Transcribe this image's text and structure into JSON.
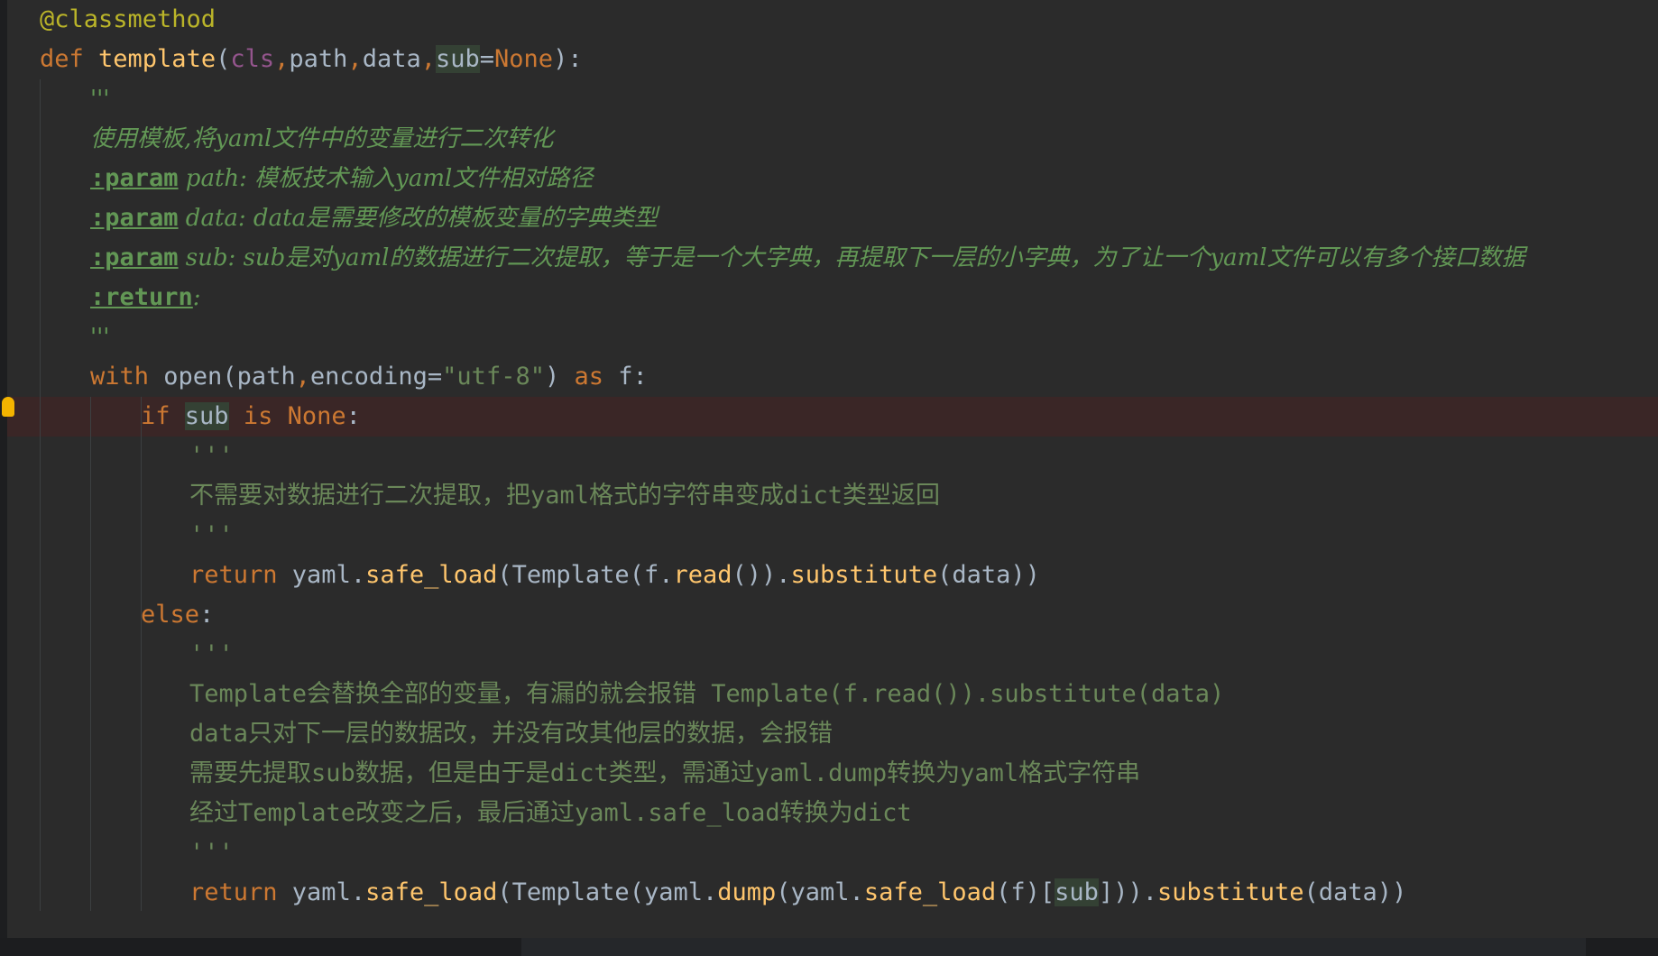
{
  "code_lines": [
    {
      "indent": 0,
      "tokens": [
        {
          "t": "@classmethod",
          "c": "dec"
        }
      ]
    },
    {
      "indent": 0,
      "tokens": [
        {
          "t": "def ",
          "c": "kw"
        },
        {
          "t": "template",
          "c": "fn"
        },
        {
          "t": "(",
          "c": "call"
        },
        {
          "t": "cls",
          "c": "self"
        },
        {
          "t": ",",
          "c": "kw"
        },
        {
          "t": "path",
          "c": "call"
        },
        {
          "t": ",",
          "c": "kw"
        },
        {
          "t": "data",
          "c": "call"
        },
        {
          "t": ",",
          "c": "kw"
        },
        {
          "t": "sub",
          "c": "hlvar"
        },
        {
          "t": "=",
          "c": "call"
        },
        {
          "t": "None",
          "c": "kw"
        },
        {
          "t": "):",
          "c": "call"
        }
      ]
    },
    {
      "indent": 1,
      "tokens": [
        {
          "t": "'''",
          "c": "cmt"
        }
      ]
    },
    {
      "indent": 1,
      "tokens": [
        {
          "t": "使用模板,将yaml文件中的变量进行二次转化",
          "c": "cmt"
        }
      ]
    },
    {
      "indent": 1,
      "tokens": [
        {
          "t": ":param",
          "c": "tag"
        },
        {
          "t": " path: 模板技术输入yaml文件相对路径",
          "c": "cmt"
        }
      ]
    },
    {
      "indent": 1,
      "tokens": [
        {
          "t": ":param",
          "c": "tag"
        },
        {
          "t": " data: data是需要修改的模板变量的字典类型",
          "c": "cmt"
        }
      ]
    },
    {
      "indent": 1,
      "tokens": [
        {
          "t": ":param",
          "c": "tag"
        },
        {
          "t": " sub: sub是对yaml的数据进行二次提取，等于是一个大字典，再提取下一层的小字典，为了让一个yaml文件可以有多个接口数据",
          "c": "cmt"
        }
      ]
    },
    {
      "indent": 1,
      "tokens": [
        {
          "t": ":return",
          "c": "tag"
        },
        {
          "t": ":",
          "c": "cmt"
        }
      ]
    },
    {
      "indent": 1,
      "tokens": [
        {
          "t": "'''",
          "c": "cmt"
        }
      ]
    },
    {
      "indent": 1,
      "tokens": [
        {
          "t": "with ",
          "c": "kw"
        },
        {
          "t": "open",
          "c": "call"
        },
        {
          "t": "(path",
          "c": "call"
        },
        {
          "t": ",",
          "c": "kw"
        },
        {
          "t": "encoding=",
          "c": "call"
        },
        {
          "t": "\"utf-8\"",
          "c": "str"
        },
        {
          "t": ") ",
          "c": "call"
        },
        {
          "t": "as ",
          "c": "kw"
        },
        {
          "t": "f:",
          "c": "call"
        }
      ]
    },
    {
      "indent": 2,
      "highlight": true,
      "tokens": [
        {
          "t": "if ",
          "c": "kw"
        },
        {
          "t": "sub",
          "c": "hlvar"
        },
        {
          "t": " is ",
          "c": "kw"
        },
        {
          "t": "None",
          "c": "kw"
        },
        {
          "t": ":",
          "c": "call"
        }
      ]
    },
    {
      "indent": 3,
      "tokens": [
        {
          "t": "'''",
          "c": "green"
        }
      ]
    },
    {
      "indent": 3,
      "tokens": [
        {
          "t": "不需要对数据进行二次提取，把yaml格式的字符串变成dict类型返回",
          "c": "green"
        }
      ]
    },
    {
      "indent": 3,
      "tokens": [
        {
          "t": "'''",
          "c": "green"
        }
      ]
    },
    {
      "indent": 3,
      "tokens": [
        {
          "t": "return ",
          "c": "kw"
        },
        {
          "t": "yaml.",
          "c": "call"
        },
        {
          "t": "safe_load",
          "c": "method"
        },
        {
          "t": "(Template(f.",
          "c": "call"
        },
        {
          "t": "read",
          "c": "method"
        },
        {
          "t": "()).",
          "c": "call"
        },
        {
          "t": "substitute",
          "c": "method"
        },
        {
          "t": "(data))",
          "c": "call"
        }
      ]
    },
    {
      "indent": 2,
      "tokens": [
        {
          "t": "else",
          "c": "kw"
        },
        {
          "t": ":",
          "c": "call"
        }
      ]
    },
    {
      "indent": 3,
      "tokens": [
        {
          "t": "'''",
          "c": "green"
        }
      ]
    },
    {
      "indent": 3,
      "tokens": [
        {
          "t": "Template会替换全部的变量，有漏的就会报错 Template(f.read()).substitute(data)",
          "c": "green"
        }
      ]
    },
    {
      "indent": 3,
      "tokens": [
        {
          "t": "data只对下一层的数据改，并没有改其他层的数据，会报错",
          "c": "green"
        }
      ]
    },
    {
      "indent": 3,
      "tokens": [
        {
          "t": "需要先提取sub数据，但是由于是dict类型，需通过yaml.dump转换为yaml格式字符串",
          "c": "green"
        }
      ]
    },
    {
      "indent": 3,
      "tokens": [
        {
          "t": "经过Template改变之后，最后通过yaml.safe_load转换为dict",
          "c": "green"
        }
      ]
    },
    {
      "indent": 3,
      "tokens": [
        {
          "t": "'''",
          "c": "green"
        }
      ]
    },
    {
      "indent": 3,
      "tokens": [
        {
          "t": "return ",
          "c": "kw"
        },
        {
          "t": "yaml.",
          "c": "call"
        },
        {
          "t": "safe_load",
          "c": "method"
        },
        {
          "t": "(Template(yaml.",
          "c": "call"
        },
        {
          "t": "dump",
          "c": "method"
        },
        {
          "t": "(yaml.",
          "c": "call"
        },
        {
          "t": "safe_load",
          "c": "method"
        },
        {
          "t": "(f)[",
          "c": "call"
        },
        {
          "t": "sub",
          "c": "hlvar"
        },
        {
          "t": "])).",
          "c": "call"
        },
        {
          "t": "substitute",
          "c": "method"
        },
        {
          "t": "(data))",
          "c": "call"
        }
      ]
    }
  ],
  "colors": {
    "editor_bg": "#2b2b2b",
    "keyword": "#cc7832",
    "function": "#ffc66d",
    "decorator": "#bbb529",
    "string": "#6a8759",
    "docstring": "#629755",
    "highlight_line": "#3a2626"
  }
}
